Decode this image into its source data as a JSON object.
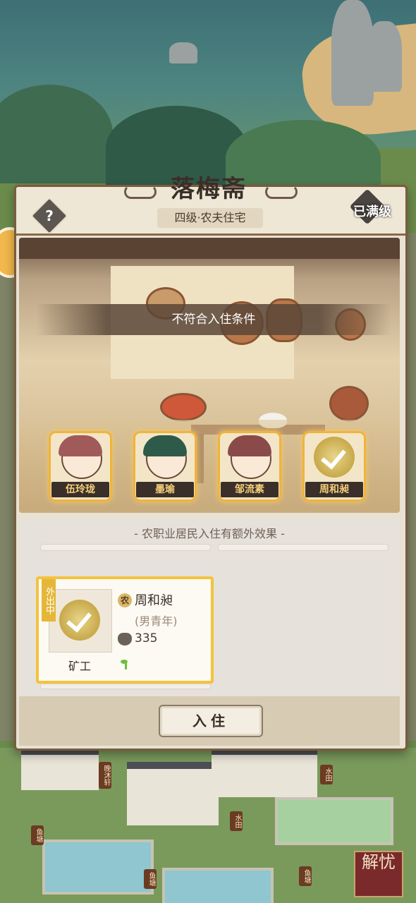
{
  "building": {
    "name": "落梅斋",
    "subtitle": "四级·农夫住宅",
    "level_status": "已满级",
    "help_label": "?",
    "notice": "不符合入住条件"
  },
  "residents": [
    {
      "name": "伍玲珑",
      "hair_color": "#a05a5a",
      "checked": false
    },
    {
      "name": "墨瑜",
      "hair_color": "#2e5a4a",
      "checked": false
    },
    {
      "name": "邹流素",
      "hair_color": "#8a4a4a",
      "checked": false
    },
    {
      "name": "周和昶",
      "hair_color": "#c8a94a",
      "checked": true
    }
  ],
  "hint": "- 农职业居民入住有额外效果 -",
  "candidate": {
    "status_tag": "外出中",
    "name": "周和昶",
    "profession_badge": "农",
    "role": "(男青年)",
    "value": "335",
    "job": "矿工"
  },
  "enter_button": "入住",
  "map_signs": [
    "晚沐轩",
    "鱼塘",
    "水田",
    "鱼塘",
    "水田",
    "鱼塘"
  ],
  "corner_logo": "解忧",
  "colors": {
    "accent_gold": "#f3c33c",
    "panel_bg": "#e9e2d3",
    "frame_brown": "#7a5c3e"
  }
}
